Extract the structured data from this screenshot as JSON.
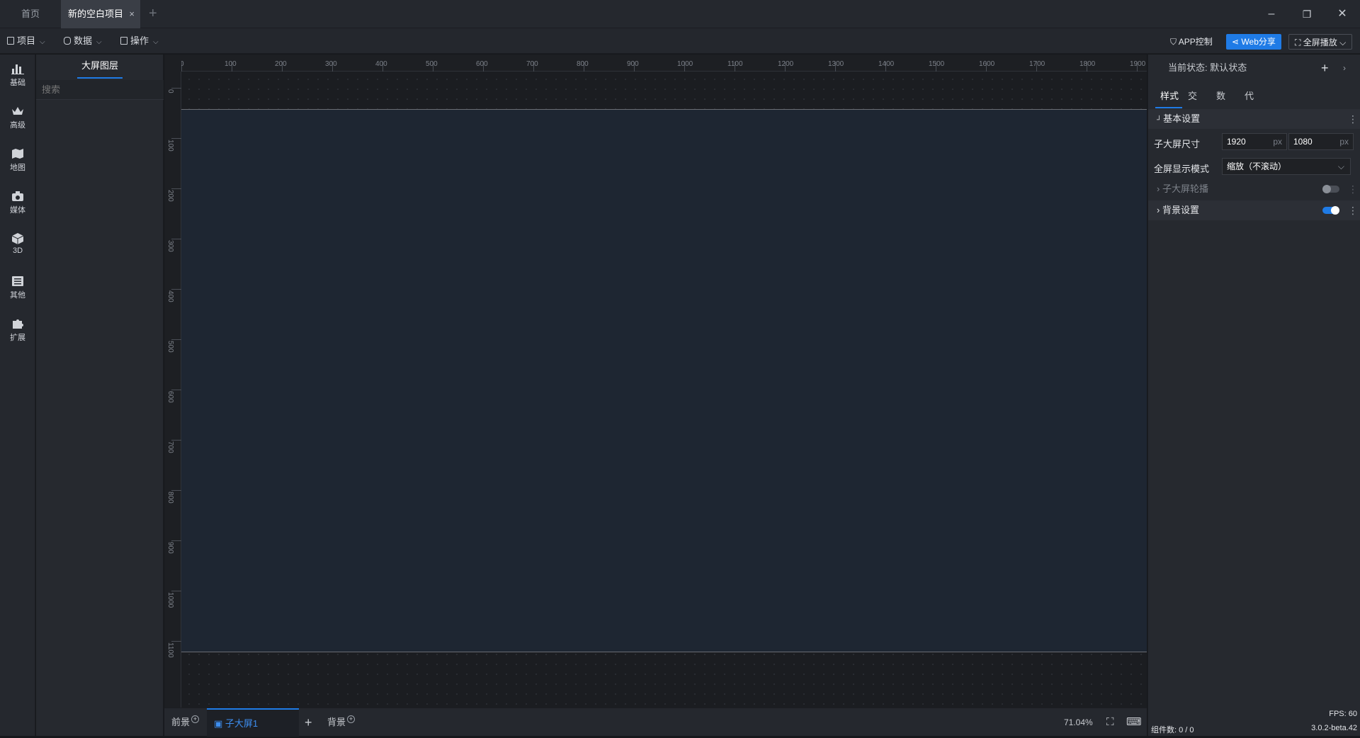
{
  "tabs": {
    "home": "首页",
    "active": "新的空白项目",
    "close": "×",
    "add": "+"
  },
  "window": {
    "minimize": "–",
    "restore": "❐",
    "close": "✕"
  },
  "menubar": {
    "project": "项目",
    "data": "数据",
    "operate": "操作",
    "app_control": "APP控制",
    "web_share": "Web分享",
    "fullscreen_play": "全屏播放"
  },
  "categories": [
    "基础",
    "高级",
    "地图",
    "媒体",
    "3D",
    "其他",
    "扩展"
  ],
  "layers": {
    "tab": "大屏图层",
    "search_placeholder": "搜索"
  },
  "ruler": {
    "h": [
      "0",
      "100",
      "200",
      "300",
      "400",
      "500",
      "600",
      "700",
      "800",
      "900",
      "1000",
      "1100",
      "1200",
      "1300",
      "1400",
      "1500",
      "1600",
      "1700",
      "1800",
      "1900"
    ],
    "v": [
      "0",
      "100",
      "200",
      "300",
      "400",
      "500",
      "600",
      "700",
      "800",
      "900",
      "1000",
      "1100"
    ]
  },
  "bottom": {
    "foreground": "前景",
    "sub_screen": "子大屏1",
    "add": "+",
    "background": "背景",
    "zoom": "71.04%",
    "component_count": "组件数: 0 / 0"
  },
  "status": {
    "fps": "FPS: 60",
    "version": "3.0.2-beta.42"
  },
  "props": {
    "current_state_label": "当前状态:",
    "current_state_value": "默认状态",
    "tabs": [
      "样式",
      "交互",
      "数据",
      "代码"
    ],
    "basic_settings": "基本设置",
    "size_label": "子大屏尺寸",
    "width": "1920",
    "height": "1080",
    "unit": "px",
    "display_mode_label": "全屏显示模式",
    "display_mode_value": "缩放（不滚动）",
    "carousel": "子大屏轮播",
    "carousel_enabled": false,
    "background_settings": "背景设置",
    "background_enabled": true
  },
  "colors": {
    "accent": "#1f7be6",
    "canvas": "#1e2632",
    "panel": "#26292f"
  }
}
